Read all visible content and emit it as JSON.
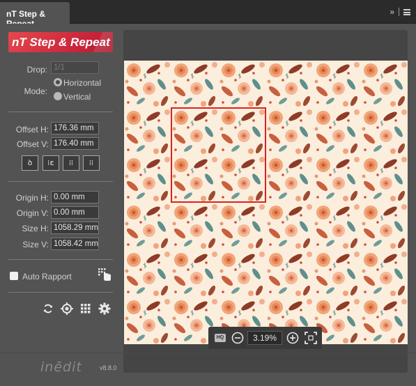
{
  "tab": {
    "title": "nT Step & Repeat",
    "expand_label": "»"
  },
  "logo": {
    "text": "nT Step & Repeat"
  },
  "drop": {
    "label": "Drop:",
    "value": "1/1"
  },
  "mode": {
    "label": "Mode:",
    "options": [
      "Horizontal",
      "Vertical"
    ],
    "selected": "Horizontal"
  },
  "offset": {
    "h_label": "Offset H:",
    "h_value": "176.36 mm",
    "v_label": "Offset V:",
    "v_value": "176.40 mm"
  },
  "step_buttons": [
    "ꝺ",
    "⁞ε",
    "⁞⁞",
    "⁞⁞"
  ],
  "origin": {
    "h_label": "Origin H:",
    "h_value": "0.00 mm",
    "v_label": "Origin V:",
    "v_value": "0.00 mm"
  },
  "size": {
    "h_label": "Size H:",
    "h_value": "1058.29 mm",
    "v_label": "Size V:",
    "v_value": "1058.42 mm"
  },
  "auto_rapport": {
    "label": "Auto Rapport",
    "checked": false
  },
  "zoom": {
    "quality_label": "HQ",
    "value": "3.19%"
  },
  "footer": {
    "brand": "inēdit",
    "version": "v8.8.0"
  },
  "colors": {
    "panel": "#535353",
    "accent_red": "#d9231e",
    "pattern_bg": "#fbeedd"
  }
}
